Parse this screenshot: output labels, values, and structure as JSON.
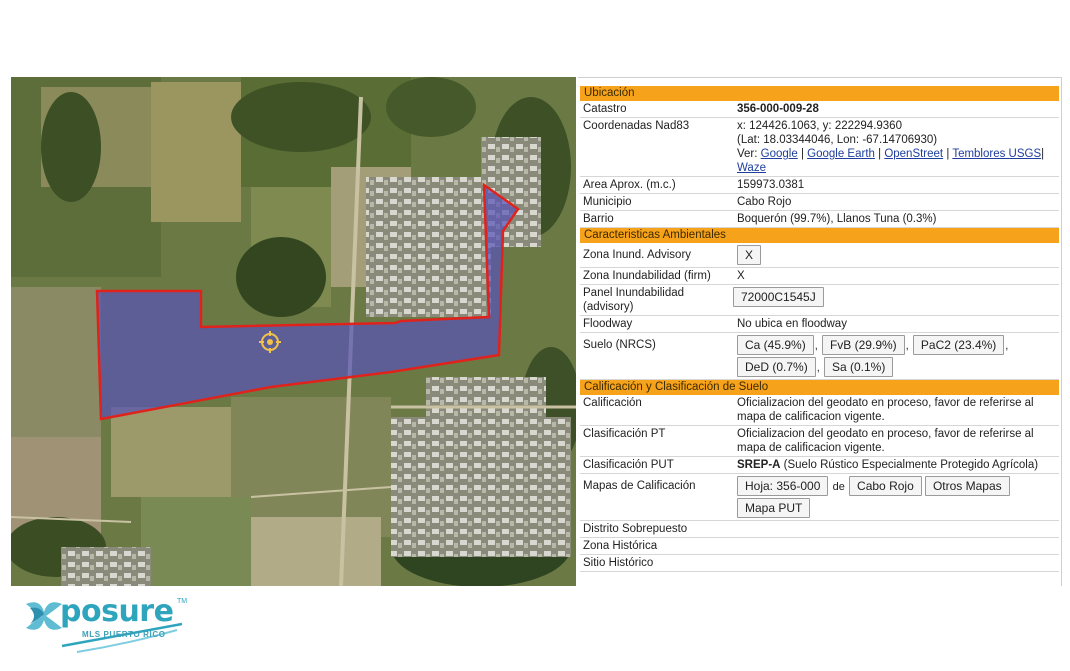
{
  "panel": {
    "section_ubicacion": "Ubicación",
    "catastro_label": "Catastro",
    "catastro_value": "356-000-009-28",
    "coord_label": "Coordenadas Nad83",
    "coord_xy": "x: 124426.1063, y: 222294.9360",
    "coord_latlon": "(Lat: 18.03344046, Lon: -67.14706930)",
    "ver_label": "Ver:",
    "link_google": "Google",
    "link_earth": "Google Earth",
    "link_openstreet": "OpenStreet",
    "link_temblores": "Temblores USGS",
    "link_waze": "Waze",
    "area_label": "Area Aprox. (m.c.)",
    "area_value": "159973.0381",
    "municipio_label": "Municipio",
    "municipio_value": "Cabo Rojo",
    "barrio_label": "Barrio",
    "barrio_value": "Boquerón (99.7%), Llanos Tuna (0.3%)",
    "section_ambientales": "Caracteristicas Ambientales",
    "zona_inund_adv_label": "Zona Inund. Advisory",
    "zona_inund_adv_value": "X",
    "zona_inund_firm_label": "Zona Inundabilidad (firm)",
    "zona_inund_firm_value": "X",
    "panel_inund_label": "Panel Inundabilidad (advisory)",
    "panel_inund_value": "72000C1545J",
    "floodway_label": "Floodway",
    "floodway_value": "No ubica en floodway",
    "suelo_label": "Suelo (NRCS)",
    "suelos": [
      "Ca (45.9%)",
      "FvB (29.9%)",
      "PaC2 (23.4%)",
      "DeD (0.7%)",
      "Sa (0.1%)"
    ],
    "section_calificacion": "Calificación y Clasificación de Suelo",
    "calificacion_label": "Calificación",
    "calificacion_value": "Oficializacion del geodato en proceso, favor de referirse al mapa de calificacion vigente.",
    "clasif_pt_label": "Clasificación PT",
    "clasif_pt_value": "Oficializacion del geodato en proceso, favor de referirse al mapa de calificacion vigente.",
    "clasif_put_label": "Clasificación PUT",
    "clasif_put_code": "SREP-A",
    "clasif_put_desc": "(Suelo Rústico Especialmente Protegido Agrícola)",
    "mapas_label": "Mapas de Calificación",
    "btn_hoja": "Hoja: 356-000",
    "de": "de",
    "btn_cabo": "Cabo Rojo",
    "btn_otros": "Otros Mapas",
    "btn_put": "Mapa PUT",
    "distrito_label": "Distrito Sobrepuesto",
    "zona_hist_label": "Zona Histórica",
    "sitio_hist_label": "Sitio Histórico"
  },
  "logo": {
    "word": "posure",
    "tm": "TM",
    "sub": "MLS PUERTO RICO"
  },
  "colors": {
    "section_header": "#f7a21b",
    "parcel_outline": "#e0221c",
    "link": "#1f3e9e",
    "logo": "#2ea4bd"
  }
}
